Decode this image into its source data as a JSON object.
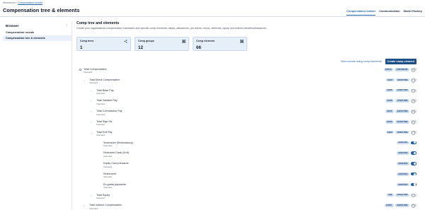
{
  "breadcrumb": {
    "root": "Workbench",
    "separator": "/",
    "current": "Compensation builder"
  },
  "page_title": "Compensation tree & elements",
  "top_tabs": [
    {
      "label": "Compensation builder",
      "active": true
    },
    {
      "label": "Communication",
      "active": false
    },
    {
      "label": "Model Factory",
      "active": false
    }
  ],
  "sidebar": {
    "title": "Browser",
    "collapse_icon": "chevron-left-icon",
    "items": [
      {
        "label": "Compensation rounds",
        "active": false
      },
      {
        "label": "Compensation tree & elements",
        "active": true
      }
    ]
  },
  "main": {
    "title": "Comp tree and elements",
    "description": "Create your organizations compensation framework and specific comp elements: salary, allowances, per diems, bonus, deferrals, equity and indirect benefits/allowances.",
    "stats": [
      {
        "label": "Comp trees",
        "value": "1",
        "icon": "share-icon"
      },
      {
        "label": "Comp groups",
        "value": "12",
        "icon": "grid-icon"
      },
      {
        "label": "Comp elements",
        "value": "66",
        "icon": "grid-icon"
      }
    ],
    "link_action": "View rounds using comp elements",
    "primary_action": "Create comp element"
  },
  "colors": {
    "accent": "#1d64b0",
    "primary_button": "#1d4f86",
    "stat_bg": "#e6eef8",
    "pill_bg": "#c9dcf0",
    "toggle_on": "#1d5fa8"
  },
  "tree": [
    {
      "name": "Total Compensation",
      "type": "Standard",
      "codes": [
        "ENTCH",
        "EOBTIMCNE"
      ],
      "expanded": true,
      "toggle": "off"
    },
    {
      "name": "Total Direct Compensation",
      "type": "Standard",
      "codes": [
        "EOAT",
        "EOAT1TINE"
      ],
      "expanded": true,
      "toggle": "off"
    },
    {
      "name": "Total Base Pay",
      "type": "Standard",
      "codes": [
        "EOBP",
        "EOBP1TINE"
      ],
      "expanded": false,
      "toggle": "off"
    },
    {
      "name": "Total Variable Pay",
      "type": "Standard",
      "codes": [
        "EOVP",
        "EOVP1TINE"
      ],
      "expanded": false,
      "toggle": "off"
    },
    {
      "name": "Total Commission Pay",
      "type": "Standard",
      "codes": [
        "EOCP",
        "EOCP1TINE"
      ],
      "expanded": false,
      "toggle": "off"
    },
    {
      "name": "Total Sign On",
      "type": "Standard",
      "codes": [
        "EOSO",
        "EOSO1TINE"
      ],
      "expanded": false,
      "toggle": "off"
    },
    {
      "name": "Total Exit Pay",
      "type": "Standard",
      "codes": [
        "EXEP",
        "EOEP1TINE"
      ],
      "expanded": true,
      "toggle": "off"
    },
    {
      "name": "Severance (Redundancy)",
      "type": "Standard",
      "codes": [
        "EOEP1001"
      ],
      "expanded": null,
      "toggle": "on"
    },
    {
      "name": "Restricted Cash (Exit)",
      "type": "Standard",
      "codes": [
        "EOEP1002"
      ],
      "expanded": null,
      "toggle": "on"
    },
    {
      "name": "Equity Carry forwards",
      "type": "Standard",
      "codes": [
        "EOEP1003"
      ],
      "expanded": null,
      "toggle": "on"
    },
    {
      "name": "Retirement",
      "type": "Standard",
      "codes": [
        "EOEP1004"
      ],
      "expanded": null,
      "toggle": "on"
    },
    {
      "name": "Ex-gratia payments",
      "type": "Standard",
      "codes": [
        "EOEP1005"
      ],
      "expanded": null,
      "toggle": "on"
    },
    {
      "name": "Total Equity",
      "type": "Standard",
      "codes": [
        "EQE",
        "EOEQ1TINE"
      ],
      "expanded": false,
      "toggle": "off"
    },
    {
      "name": "Total Indirect Compensation",
      "type": "Standard",
      "codes": [
        "EOINT",
        "EOINT1TINE"
      ],
      "expanded": false,
      "toggle": "off"
    }
  ]
}
